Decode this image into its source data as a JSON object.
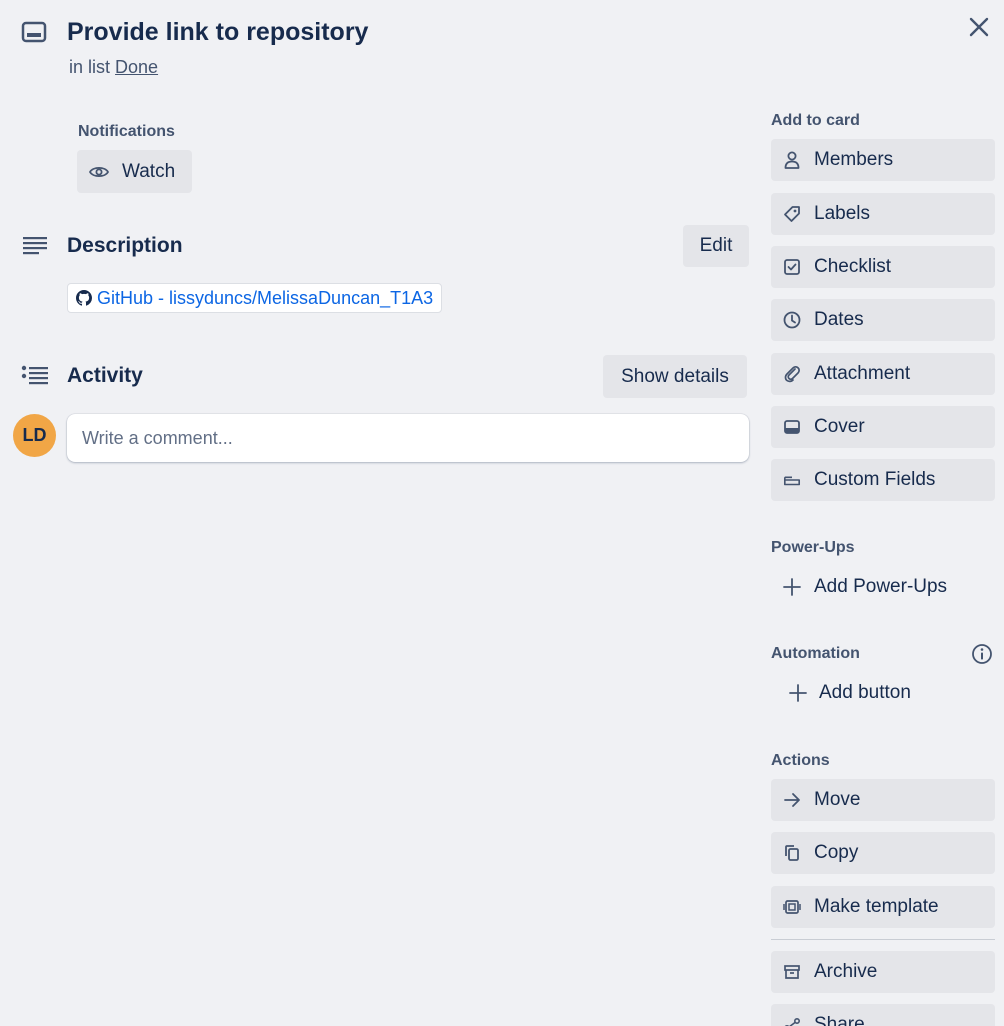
{
  "card": {
    "title": "Provide link to repository",
    "in_list_prefix": "in list",
    "list_name": "Done"
  },
  "notifications": {
    "label": "Notifications",
    "watch_label": "Watch"
  },
  "description": {
    "title": "Description",
    "edit_label": "Edit",
    "link_text": "GitHub - lissyduncs/MelissaDuncan_T1A3"
  },
  "activity": {
    "title": "Activity",
    "show_details_label": "Show details",
    "avatar_initials": "LD",
    "comment_placeholder": "Write a comment..."
  },
  "sidebar": {
    "add_to_card": {
      "label": "Add to card",
      "items": [
        {
          "label": "Members",
          "icon": "person-icon"
        },
        {
          "label": "Labels",
          "icon": "tag-icon"
        },
        {
          "label": "Checklist",
          "icon": "checkbox-icon"
        },
        {
          "label": "Dates",
          "icon": "clock-icon"
        },
        {
          "label": "Attachment",
          "icon": "paperclip-icon"
        },
        {
          "label": "Cover",
          "icon": "cover-icon"
        },
        {
          "label": "Custom Fields",
          "icon": "custom-fields-icon"
        }
      ]
    },
    "power_ups": {
      "label": "Power-Ups",
      "add_label": "Add Power-Ups"
    },
    "automation": {
      "label": "Automation",
      "add_label": "Add button"
    },
    "actions": {
      "label": "Actions",
      "items": [
        {
          "label": "Move",
          "icon": "arrow-right-icon"
        },
        {
          "label": "Copy",
          "icon": "copy-icon"
        },
        {
          "label": "Make template",
          "icon": "template-icon"
        },
        {
          "label": "Archive",
          "icon": "archive-icon"
        },
        {
          "label": "Share",
          "icon": "share-icon"
        }
      ]
    }
  },
  "colors": {
    "background": "#f0f1f4",
    "button_bg": "#e4e5e9",
    "text": "#172b4d",
    "subtle_text": "#44546f",
    "link": "#0c66e4",
    "avatar": "#f1a646"
  }
}
